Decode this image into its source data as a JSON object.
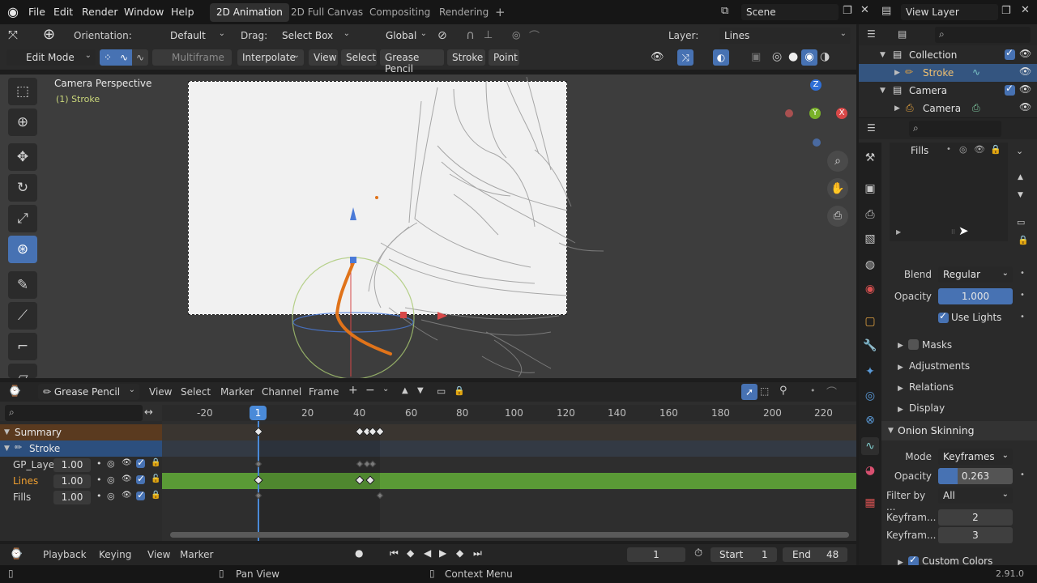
{
  "menu": [
    "File",
    "Edit",
    "Render",
    "Window",
    "Help"
  ],
  "workspaces": [
    "2D Animation",
    "2D Full Canvas",
    "Compositing",
    "Rendering"
  ],
  "scene": "Scene",
  "view_layer": "View Layer",
  "toolbar": {
    "orientation_label": "Orientation:",
    "orientation_value": "Default",
    "drag_label": "Drag:",
    "drag_value": "Select Box",
    "transform": "Global",
    "layer_label": "Layer:",
    "layer_value": "Lines"
  },
  "header2": {
    "mode": "Edit Mode",
    "multiframe": "Multiframe",
    "interpolate": "Interpolate",
    "menus": [
      "View",
      "Select",
      "Grease Pencil",
      "Stroke",
      "Point"
    ]
  },
  "viewport": {
    "title": "Camera Perspective",
    "subtitle": "(1) Stroke",
    "axis_z": "Z",
    "axis_y": "Y",
    "axis_x": "X"
  },
  "outliner": {
    "rows": [
      {
        "label": "Collection"
      },
      {
        "label": "Stroke"
      },
      {
        "label": "Camera"
      },
      {
        "label": "Camera"
      }
    ]
  },
  "properties": {
    "layer_list_item": "Fills",
    "blend_label": "Blend",
    "blend_value": "Regular",
    "opacity_label": "Opacity",
    "opacity_value": "1.000",
    "use_lights": "Use Lights",
    "sections": [
      "Masks",
      "Adjustments",
      "Relations",
      "Display"
    ],
    "onion_title": "Onion Skinning",
    "mode_label": "Mode",
    "mode_value": "Keyframes",
    "onion_opacity_label": "Opacity",
    "onion_opacity_value": "0.263",
    "onion_opacity_fraction": 0.263,
    "filter_label": "Filter by ...",
    "filter_value": "All",
    "kf_before_label": "Keyfram...",
    "kf_before_value": "2",
    "kf_after_label": "Keyfram...",
    "kf_after_value": "3",
    "custom_colors": "Custom Colors"
  },
  "dopesheet": {
    "mode": "Grease Pencil",
    "menus": [
      "View",
      "Select",
      "Marker",
      "Channel",
      "Frame"
    ],
    "ruler": [
      "-20",
      "1",
      "20",
      "40",
      "60",
      "80",
      "100",
      "120",
      "140",
      "160",
      "180",
      "200",
      "220"
    ],
    "channels": [
      {
        "name": "Summary"
      },
      {
        "name": "Stroke"
      },
      {
        "name": "GP_Layer",
        "value": "1.00"
      },
      {
        "name": "Lines",
        "value": "1.00"
      },
      {
        "name": "Fills",
        "value": "1.00"
      }
    ]
  },
  "timeline": {
    "playback": "Playback",
    "keying": "Keying",
    "view": "View",
    "marker": "Marker",
    "current_frame": "1",
    "start_label": "Start",
    "start_value": "1",
    "end_label": "End",
    "end_value": "48"
  },
  "status": {
    "pan": "Pan View",
    "context": "Context Menu",
    "version": "2.91.0"
  },
  "colors": {
    "accent": "#4772b3",
    "selection": "#345580",
    "active_channel": "#5a9a36",
    "stroke_orange": "#e0731a",
    "playhead": "#4a8ad8"
  }
}
